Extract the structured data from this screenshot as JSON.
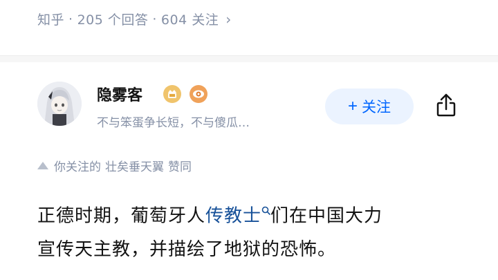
{
  "question_meta": {
    "source": "知乎",
    "answers_count": "205 个回答",
    "followers_count": "604 关注",
    "separator": "·",
    "chevron": "›"
  },
  "author": {
    "name": "隐雾客",
    "bio": "不与笨蛋争长短，不与傻瓜…",
    "badges": [
      "gold-badge-icon",
      "eye-badge-icon"
    ]
  },
  "actions": {
    "follow_plus": "+",
    "follow_label": "关注",
    "share_icon": "share-icon"
  },
  "activity": {
    "prefix": "你关注的",
    "user": "壮矣垂天翼",
    "action": "赞同"
  },
  "answer": {
    "line1_pre": "正德时期，葡萄牙人",
    "line1_link": "传教士",
    "line1_post": "们在中国大力",
    "line2": "宣传天主教，并描绘了地狱的恐怖。"
  },
  "colors": {
    "accent": "#0066ff",
    "link": "#175199",
    "muted": "#8590a6",
    "follow_bg": "#ebf3ff"
  }
}
